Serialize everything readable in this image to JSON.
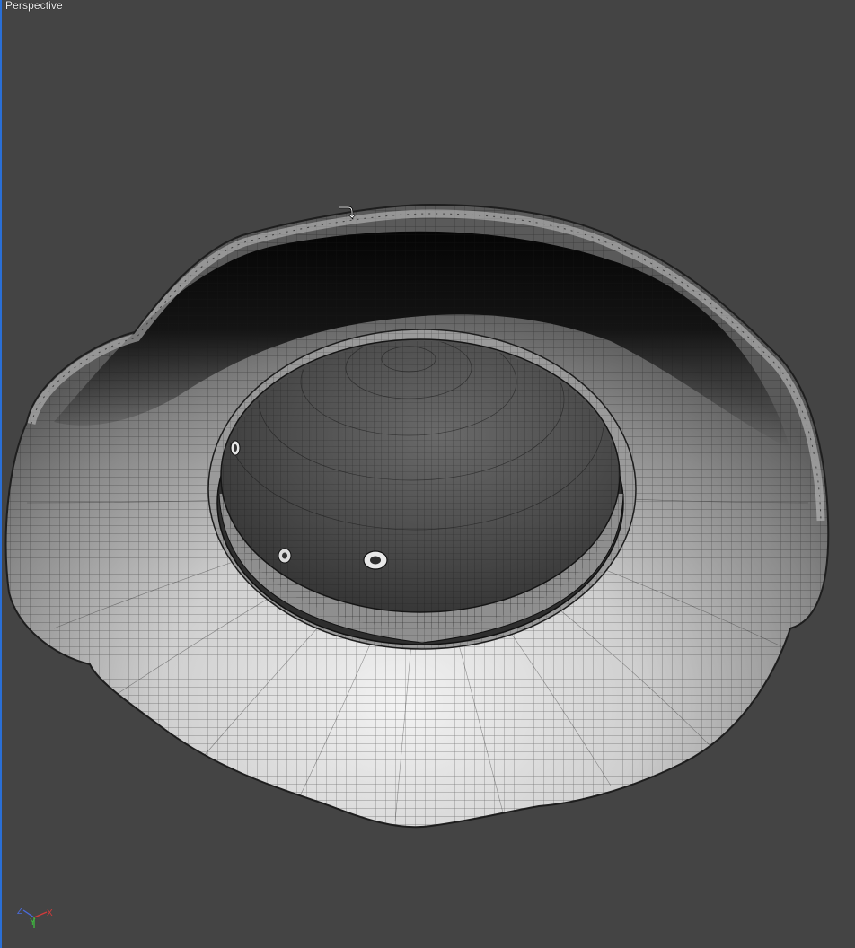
{
  "viewport": {
    "label": "Perspective",
    "background_color": "#444444",
    "active_border_color": "#2a6fd6"
  },
  "axis_gizmo": {
    "z_label": "Z",
    "y_label": "Y",
    "x_label": "X",
    "z_color": "#4a6bdc",
    "y_color": "#3fbf3f",
    "x_color": "#d23a3a"
  },
  "scene": {
    "object": "wireframe-shaded-dish-mesh",
    "cursor_icon": "rotate-cursor-icon",
    "detail_icons": [
      "screw-hole-icon",
      "screw-hole-icon",
      "screw-hole-icon"
    ]
  }
}
